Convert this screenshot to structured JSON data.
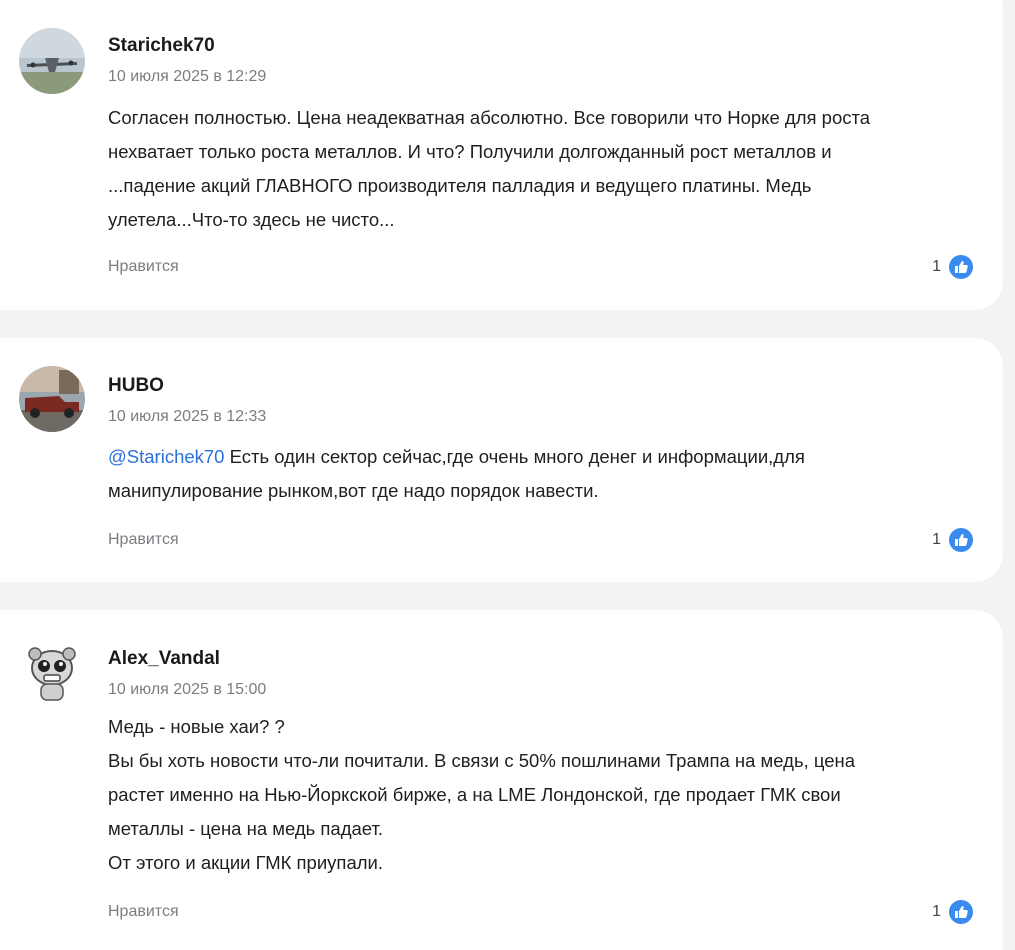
{
  "comments": [
    {
      "author": "Starichek70",
      "date": "10 июля 2025 в 12:29",
      "lines": [
        "Согласен полностью. Цена неадекватная абсолютно. Все говорили что Норке для роста",
        "нехватает только роста металлов. И что? Получили долгожданный рост металлов и",
        "...падение акций ГЛАВНОГО производителя палладия и ведущего платины. Медь",
        "улетела...Что-то здесь не чисто..."
      ],
      "like_label": "Нравится",
      "like_count": "1"
    },
    {
      "author": "HUBO",
      "date": "10 июля 2025 в 12:33",
      "mention": "@Starichek70",
      "lines": [
        " Есть один сектор сейчас,где очень много денег и информации,для",
        "манипулирование рынком,вот  где надо порядок навести."
      ],
      "like_label": "Нравится",
      "like_count": "1"
    },
    {
      "author": "Alex_Vandal",
      "date": "10 июля 2025 в 15:00",
      "lines": [
        "Медь - новые хаи? ?",
        "Вы бы хоть новости что-ли почитали. В связи с 50% пошлинами Трампа на медь, цена",
        "растет именно на Нью-Йоркской бирже, а на LME Лондонской, где продает ГМК свои",
        "металлы - цена на медь падает.",
        "От этого и акции ГМК приупали."
      ],
      "like_label": "Нравится",
      "like_count": "1"
    }
  ],
  "colors": {
    "page_bg": "#f2f3f5",
    "card_bg": "#ffffff",
    "mention": "#2b72d8",
    "like_icon": "#3a8bf0",
    "meta_text": "#7a7d82"
  }
}
